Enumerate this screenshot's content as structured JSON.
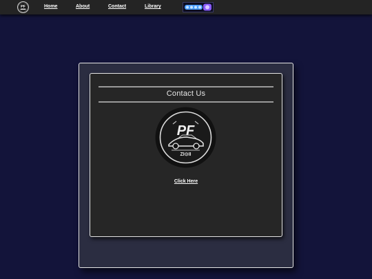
{
  "nav": {
    "logo_icon": "pf-logo-icon",
    "links": {
      "home": "Home",
      "about": "About",
      "contact": "Contact",
      "library": "Library"
    },
    "badge_icon": "game-badge-icon"
  },
  "card": {
    "title": "Contact Us",
    "logo_icon": "pf-car-logo-icon",
    "link_label": "Click Here"
  },
  "colors": {
    "page_background": "#13143a",
    "navbar": "#242424",
    "outer_panel": "#2b2d41",
    "inner_card": "#262626",
    "border": "#e6e6e6",
    "text": "#ffffff"
  }
}
